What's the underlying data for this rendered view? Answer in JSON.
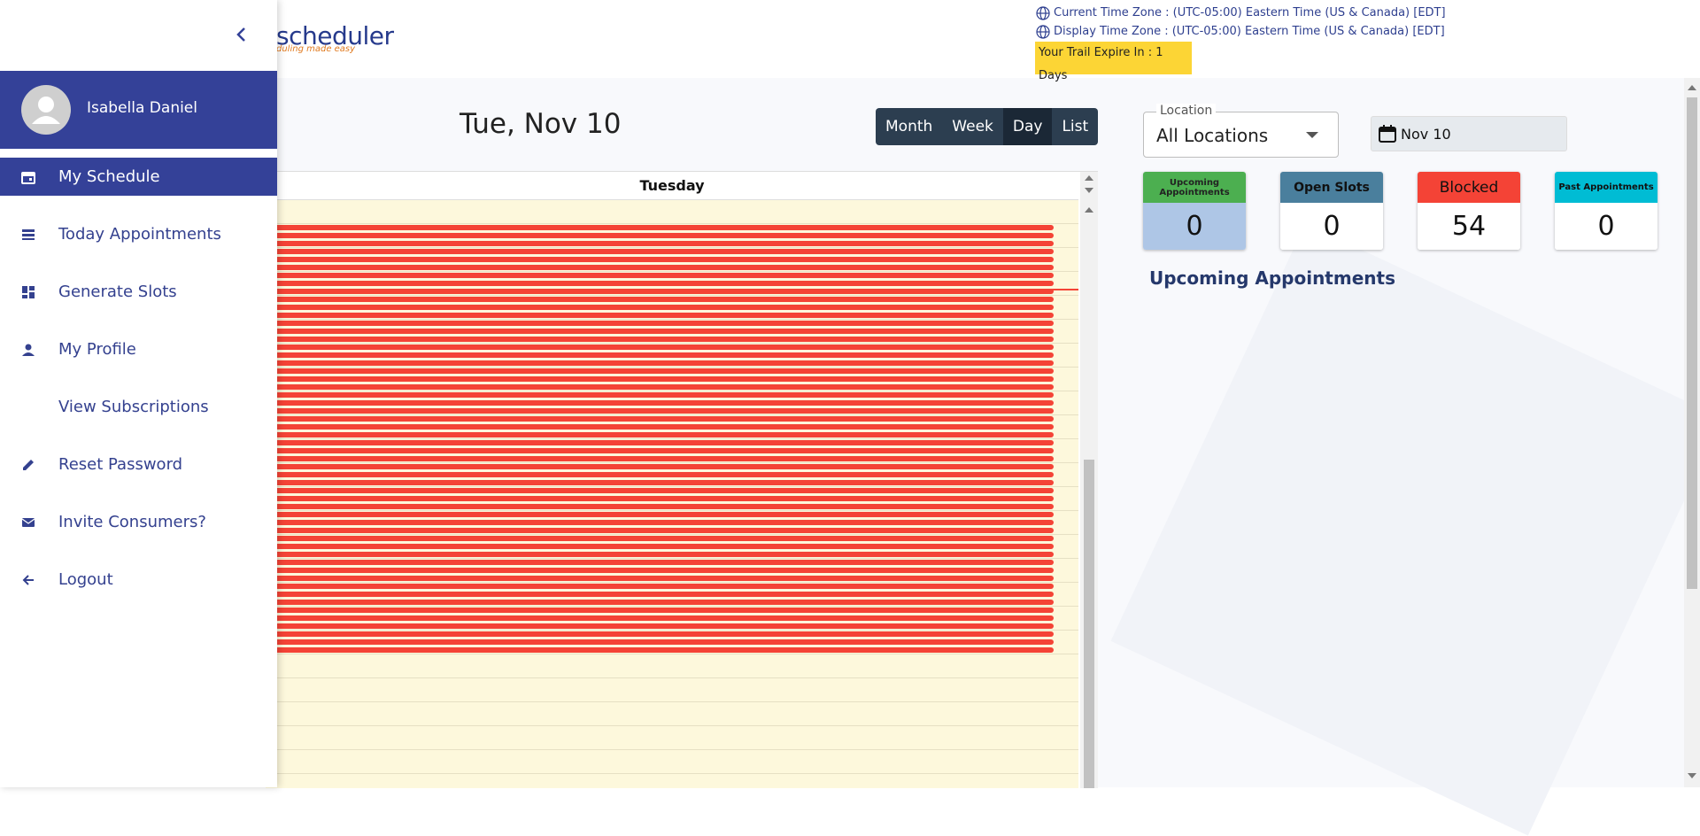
{
  "header": {
    "brand": "scheduler",
    "tagline": "duling made easy",
    "current_tz": "Current Time Zone : (UTC-05:00) Eastern Time (US & Canada) [EDT]",
    "display_tz": "Display Time Zone : (UTC-05:00) Eastern Time (US & Canada) [EDT]",
    "trial": "Your Trail Expire In : 1 Days"
  },
  "drawer": {
    "user_name": "Isabella Daniel",
    "items": [
      {
        "label": "My Schedule",
        "icon": "calendar-icon"
      },
      {
        "label": "Today Appointments",
        "icon": "list-icon"
      },
      {
        "label": "Generate Slots",
        "icon": "dashboard-icon"
      },
      {
        "label": "My Profile",
        "icon": "person-icon"
      },
      {
        "label": "View Subscriptions",
        "icon": ""
      },
      {
        "label": "Reset Password",
        "icon": "pencil-icon"
      },
      {
        "label": "Invite Consumers?",
        "icon": "mail-icon"
      },
      {
        "label": "Logout",
        "icon": "arrow-left-icon"
      }
    ]
  },
  "calendar": {
    "title": "Tue, Nov 10",
    "views": [
      "Month",
      "Week",
      "Day",
      "List"
    ],
    "active_view": "Day",
    "day_header": "Tuesday"
  },
  "filters": {
    "location_label": "Location",
    "location_value": "All Locations",
    "date_value": "Nov 10"
  },
  "stats": [
    {
      "label": "Upcoming Appointments",
      "value": "0",
      "head_color": "#4caf50",
      "body_color": "#aec6e6"
    },
    {
      "label": "Open Slots",
      "value": "0",
      "head_color": "#4a7f9d",
      "body_color": "#ffffff"
    },
    {
      "label": "Blocked",
      "value": "54",
      "head_color": "#f44336",
      "body_color": "#ffffff"
    },
    {
      "label": "Past Appointments",
      "value": "0",
      "head_color": "#00bcd4",
      "body_color": "#ffffff"
    }
  ],
  "upcoming_title": "Upcoming Appointments",
  "colors": {
    "accent": "#344198",
    "blocked": "#f44336",
    "trial_bg": "#fcd535"
  }
}
